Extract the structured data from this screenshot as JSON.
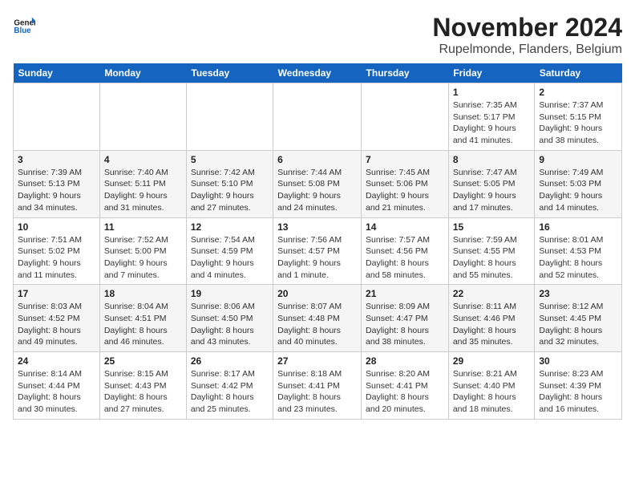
{
  "logo": {
    "general": "General",
    "blue": "Blue"
  },
  "title": "November 2024",
  "subtitle": "Rupelmonde, Flanders, Belgium",
  "days_of_week": [
    "Sunday",
    "Monday",
    "Tuesday",
    "Wednesday",
    "Thursday",
    "Friday",
    "Saturday"
  ],
  "weeks": [
    [
      {
        "day": "",
        "info": ""
      },
      {
        "day": "",
        "info": ""
      },
      {
        "day": "",
        "info": ""
      },
      {
        "day": "",
        "info": ""
      },
      {
        "day": "",
        "info": ""
      },
      {
        "day": "1",
        "info": "Sunrise: 7:35 AM\nSunset: 5:17 PM\nDaylight: 9 hours and 41 minutes."
      },
      {
        "day": "2",
        "info": "Sunrise: 7:37 AM\nSunset: 5:15 PM\nDaylight: 9 hours and 38 minutes."
      }
    ],
    [
      {
        "day": "3",
        "info": "Sunrise: 7:39 AM\nSunset: 5:13 PM\nDaylight: 9 hours and 34 minutes."
      },
      {
        "day": "4",
        "info": "Sunrise: 7:40 AM\nSunset: 5:11 PM\nDaylight: 9 hours and 31 minutes."
      },
      {
        "day": "5",
        "info": "Sunrise: 7:42 AM\nSunset: 5:10 PM\nDaylight: 9 hours and 27 minutes."
      },
      {
        "day": "6",
        "info": "Sunrise: 7:44 AM\nSunset: 5:08 PM\nDaylight: 9 hours and 24 minutes."
      },
      {
        "day": "7",
        "info": "Sunrise: 7:45 AM\nSunset: 5:06 PM\nDaylight: 9 hours and 21 minutes."
      },
      {
        "day": "8",
        "info": "Sunrise: 7:47 AM\nSunset: 5:05 PM\nDaylight: 9 hours and 17 minutes."
      },
      {
        "day": "9",
        "info": "Sunrise: 7:49 AM\nSunset: 5:03 PM\nDaylight: 9 hours and 14 minutes."
      }
    ],
    [
      {
        "day": "10",
        "info": "Sunrise: 7:51 AM\nSunset: 5:02 PM\nDaylight: 9 hours and 11 minutes."
      },
      {
        "day": "11",
        "info": "Sunrise: 7:52 AM\nSunset: 5:00 PM\nDaylight: 9 hours and 7 minutes."
      },
      {
        "day": "12",
        "info": "Sunrise: 7:54 AM\nSunset: 4:59 PM\nDaylight: 9 hours and 4 minutes."
      },
      {
        "day": "13",
        "info": "Sunrise: 7:56 AM\nSunset: 4:57 PM\nDaylight: 9 hours and 1 minute."
      },
      {
        "day": "14",
        "info": "Sunrise: 7:57 AM\nSunset: 4:56 PM\nDaylight: 8 hours and 58 minutes."
      },
      {
        "day": "15",
        "info": "Sunrise: 7:59 AM\nSunset: 4:55 PM\nDaylight: 8 hours and 55 minutes."
      },
      {
        "day": "16",
        "info": "Sunrise: 8:01 AM\nSunset: 4:53 PM\nDaylight: 8 hours and 52 minutes."
      }
    ],
    [
      {
        "day": "17",
        "info": "Sunrise: 8:03 AM\nSunset: 4:52 PM\nDaylight: 8 hours and 49 minutes."
      },
      {
        "day": "18",
        "info": "Sunrise: 8:04 AM\nSunset: 4:51 PM\nDaylight: 8 hours and 46 minutes."
      },
      {
        "day": "19",
        "info": "Sunrise: 8:06 AM\nSunset: 4:50 PM\nDaylight: 8 hours and 43 minutes."
      },
      {
        "day": "20",
        "info": "Sunrise: 8:07 AM\nSunset: 4:48 PM\nDaylight: 8 hours and 40 minutes."
      },
      {
        "day": "21",
        "info": "Sunrise: 8:09 AM\nSunset: 4:47 PM\nDaylight: 8 hours and 38 minutes."
      },
      {
        "day": "22",
        "info": "Sunrise: 8:11 AM\nSunset: 4:46 PM\nDaylight: 8 hours and 35 minutes."
      },
      {
        "day": "23",
        "info": "Sunrise: 8:12 AM\nSunset: 4:45 PM\nDaylight: 8 hours and 32 minutes."
      }
    ],
    [
      {
        "day": "24",
        "info": "Sunrise: 8:14 AM\nSunset: 4:44 PM\nDaylight: 8 hours and 30 minutes."
      },
      {
        "day": "25",
        "info": "Sunrise: 8:15 AM\nSunset: 4:43 PM\nDaylight: 8 hours and 27 minutes."
      },
      {
        "day": "26",
        "info": "Sunrise: 8:17 AM\nSunset: 4:42 PM\nDaylight: 8 hours and 25 minutes."
      },
      {
        "day": "27",
        "info": "Sunrise: 8:18 AM\nSunset: 4:41 PM\nDaylight: 8 hours and 23 minutes."
      },
      {
        "day": "28",
        "info": "Sunrise: 8:20 AM\nSunset: 4:41 PM\nDaylight: 8 hours and 20 minutes."
      },
      {
        "day": "29",
        "info": "Sunrise: 8:21 AM\nSunset: 4:40 PM\nDaylight: 8 hours and 18 minutes."
      },
      {
        "day": "30",
        "info": "Sunrise: 8:23 AM\nSunset: 4:39 PM\nDaylight: 8 hours and 16 minutes."
      }
    ]
  ]
}
